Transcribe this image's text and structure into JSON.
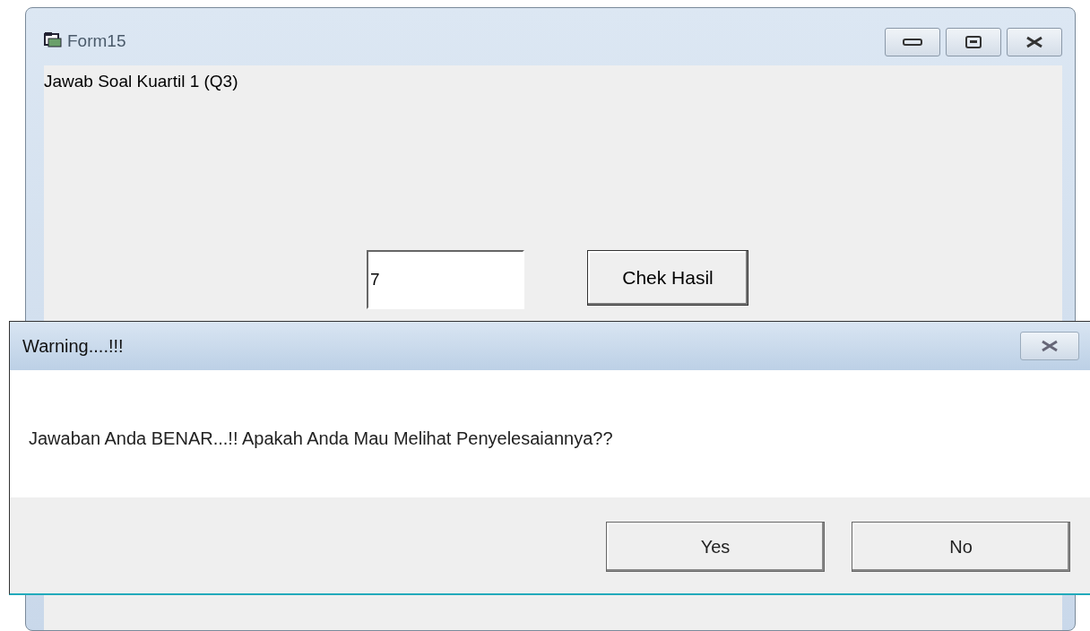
{
  "window": {
    "title": "Form15"
  },
  "form": {
    "label": "Jawab Soal Kuartil 1 (Q3)",
    "answer": "7",
    "check_button": "Chek Hasil"
  },
  "dialog": {
    "title": "Warning....!!!",
    "message": "Jawaban Anda BENAR...!! Apakah Anda Mau Melihat Penyelesaiannya??",
    "buttons": [
      "Yes",
      "No"
    ]
  }
}
